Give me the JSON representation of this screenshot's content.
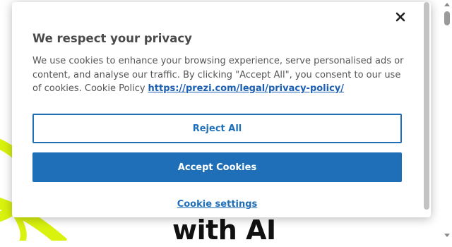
{
  "hero": {
    "text_partial": "with AI"
  },
  "cookie_banner": {
    "title": "We respect your privacy",
    "description": "We use cookies to enhance your browsing experience, serve personalised ads or content, and analyse our traffic. By clicking \"Accept All\", you consent to our use of cookies. Cookie Policy",
    "policy_link": "https://prezi.com/legal/privacy-policy/",
    "reject_label": "Reject All",
    "accept_label": "Accept Cookies",
    "settings_label": "Cookie settings",
    "close_icon": "close-icon"
  },
  "colors": {
    "accent": "#1e6fb8",
    "decor_lime": "#d9f20e",
    "title_text": "#4a4a4a"
  }
}
